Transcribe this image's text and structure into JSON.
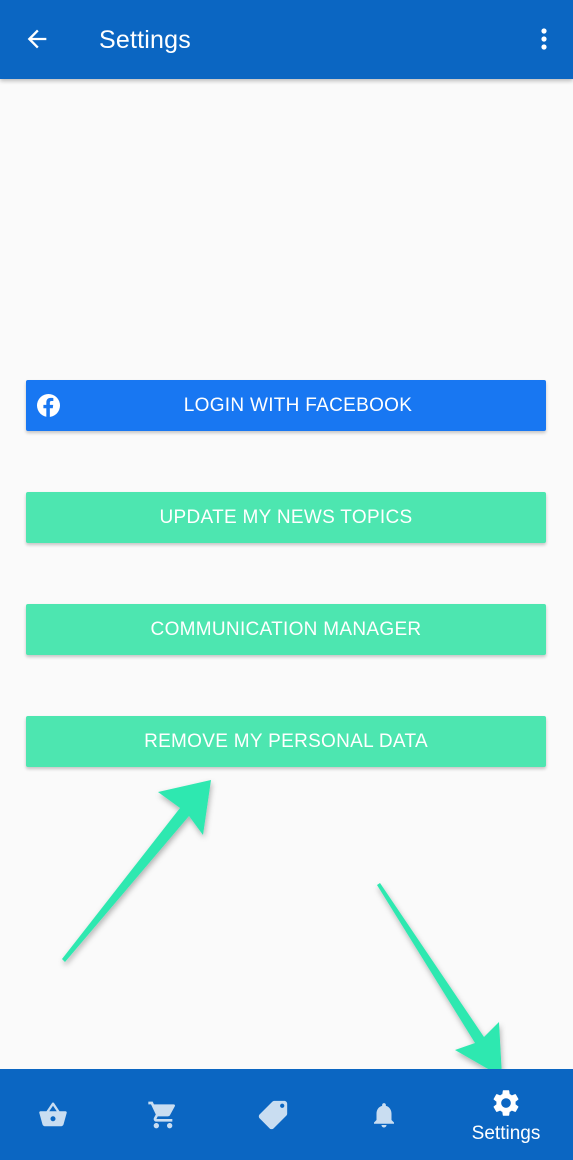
{
  "app_bar": {
    "title": "Settings",
    "back_icon": "arrow-left-icon",
    "overflow_icon": "more-vert-icon",
    "background_color": "#0b66c2"
  },
  "buttons": {
    "facebook_login": {
      "label": "LOGIN WITH FACEBOOK",
      "icon": "facebook-icon",
      "color": "#1877f2"
    },
    "update_news_topics": {
      "label": "UPDATE MY NEWS TOPICS",
      "color": "#4de6b0"
    },
    "communication_manager": {
      "label": "COMMUNICATION MANAGER",
      "color": "#4de6b0"
    },
    "remove_personal_data": {
      "label": "REMOVE MY PERSONAL DATA",
      "color": "#4de6b0"
    }
  },
  "bottom_nav": {
    "items": [
      {
        "icon": "basket-icon",
        "label": ""
      },
      {
        "icon": "cart-icon",
        "label": ""
      },
      {
        "icon": "tag-icon",
        "label": ""
      },
      {
        "icon": "bell-icon",
        "label": ""
      },
      {
        "icon": "gear-icon",
        "label": "Settings",
        "selected": true
      }
    ],
    "background_color": "#0b66c2"
  },
  "annotations": {
    "arrow_color": "#2ee8b0"
  }
}
